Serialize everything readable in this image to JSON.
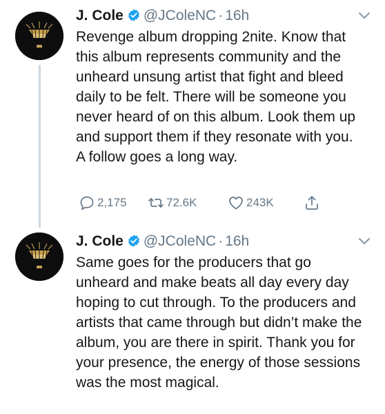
{
  "colors": {
    "text": "#14171a",
    "secondary": "#657786",
    "verified": "#1da1f2",
    "thread_line": "#ccd6dd"
  },
  "tweets": [
    {
      "name": "J. Cole",
      "handle": "@JColeNC",
      "separator": "·",
      "time": "16h",
      "verified": true,
      "text": "Revenge album dropping 2nite. Know that this album represents community and the unheard unsung artist that fight and bleed daily to be felt. There will be someone you never heard of on this album. Look them up and support them if they resonate with you. A follow goes a long way.",
      "replies": "2,175",
      "retweets": "72.6K",
      "likes": "243K"
    },
    {
      "name": "J. Cole",
      "handle": "@JColeNC",
      "separator": "·",
      "time": "16h",
      "verified": true,
      "text": "Same goes for the producers that go unheard and make beats all day every day hoping to cut through. To the producers and artists that came through but didn’t make the album, you are there in spirit. Thank you for your presence, the energy of those sessions was the most magical."
    }
  ],
  "icons": {
    "avatar": "album-art-avatar",
    "verified": "verified-badge-icon",
    "caret": "chevron-down-icon",
    "reply": "reply-icon",
    "retweet": "retweet-icon",
    "like": "heart-icon",
    "share": "share-icon"
  }
}
